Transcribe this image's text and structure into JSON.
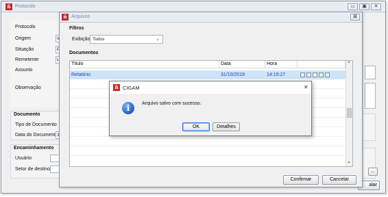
{
  "main_window": {
    "title": "Protocolo",
    "labels": {
      "protocolo": "Protocolo",
      "origem": "Origem",
      "situacao": "Situação",
      "remetente": "Remetente",
      "assunto": "Assunto",
      "observacao": "Observação"
    },
    "partial_values": {
      "origem": "In",
      "situacao": "P",
      "remetente": "Li",
      "data_documento": "3"
    },
    "documento_section": {
      "header": "Documento",
      "tipo_label": "Tipo de Documento",
      "data_label": "Data do Documento"
    },
    "encaminhamento_section": {
      "header": "Encaminhamento",
      "usuario_label": "Usuário",
      "setor_label": "Setor de destino"
    },
    "ellipsis_button": "...",
    "fechar_partial": "alar"
  },
  "arquivos_window": {
    "title": "Arquivos",
    "close_glyph": "⊠",
    "filtros_header": "Filtros",
    "exibicao_label": "Exibição",
    "exibicao_value": "Todos",
    "documentos_header": "Documentos",
    "table": {
      "columns": [
        "Título",
        "Data",
        "Hora"
      ],
      "rows": [
        {
          "titulo": "Relatório",
          "data": "31/10/2019",
          "hora": "14:15:27"
        }
      ]
    },
    "confirmar_label": "Confirmar",
    "cancelar_label": "Cancelar"
  },
  "dialog": {
    "title": "CIGAM",
    "close_glyph": "✕",
    "message": "Arquivo salvo com sucesso.",
    "ok_label": "OK",
    "detalhes_label": "Detalhes"
  },
  "icons": {
    "info": "info-icon",
    "app_logo": "cigam-logo-icon"
  },
  "colors": {
    "selection": "#cfe3f7",
    "link_text": "#1a3fb0",
    "info_blue": "#1f5fbf",
    "logo_red": "#c42a2a"
  }
}
